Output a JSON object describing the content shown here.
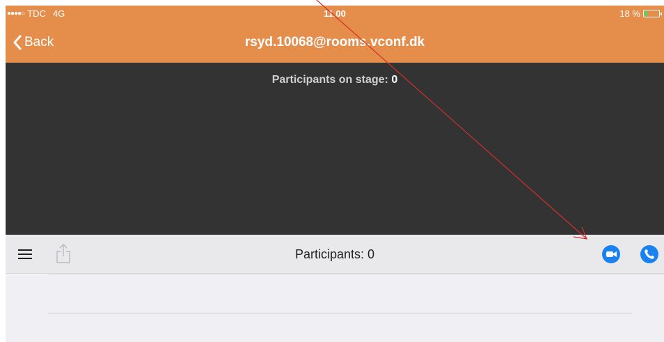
{
  "status_bar": {
    "signal_dots": "●●●●○",
    "carrier": "TDC",
    "network": "4G",
    "time": "11.00",
    "battery_percent": "18 %",
    "battery_level": 0.18
  },
  "nav": {
    "back_label": "Back",
    "title": "rsyd.10068@rooms.vconf.dk"
  },
  "stage": {
    "label": "Participants on stage:",
    "count": "0"
  },
  "toolbar": {
    "participants_label": "Participants: 0",
    "menu_icon": "hamburger-menu-icon",
    "share_icon": "share-icon",
    "video_icon": "video-camera-icon",
    "phone_icon": "phone-icon"
  },
  "colors": {
    "header": "#e58e4c",
    "stage": "#333333",
    "toolbar": "#e9e9ec",
    "accent": "#1a82f0",
    "annotation_arrow": "#d0302e"
  }
}
